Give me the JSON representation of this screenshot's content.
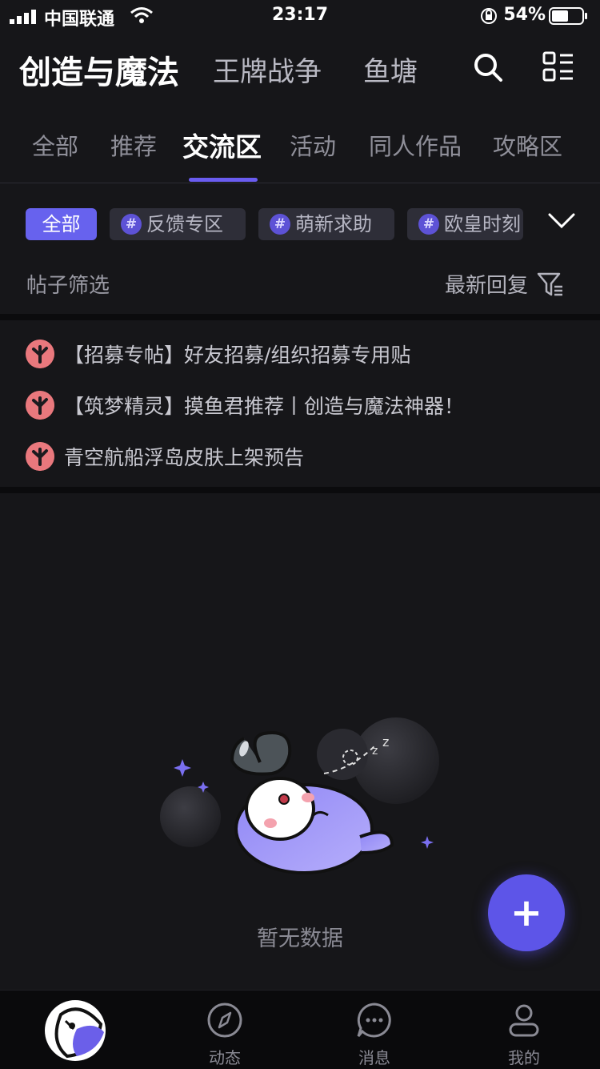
{
  "status_bar": {
    "carrier": "中国联通",
    "time": "23:17",
    "battery": "54%"
  },
  "header": {
    "games": [
      "创造与魔法",
      "王牌战争",
      "鱼塘"
    ],
    "active_game": "创造与魔法"
  },
  "subtabs": [
    "全部",
    "推荐",
    "交流区",
    "活动",
    "同人作品",
    "攻略区"
  ],
  "active_subtab": "交流区",
  "chips": [
    "全部",
    "反馈专区",
    "萌新求助",
    "欧皇时刻"
  ],
  "filter": {
    "label": "帖子筛选",
    "sort": "最新回复"
  },
  "pinned_posts": [
    "【招募专帖】好友招募/组织招募专用贴",
    "【筑梦精灵】摸鱼君推荐丨创造与魔法神器！",
    "青空航船浮岛皮肤上架预告"
  ],
  "empty_state": {
    "text": "暂无数据"
  },
  "fab": {
    "label": "+"
  },
  "bottom_nav": {
    "items": [
      "动态",
      "消息",
      "我的"
    ]
  },
  "colors": {
    "background": "#161619",
    "accent": "#6762ee",
    "pin": "#e9787d"
  }
}
